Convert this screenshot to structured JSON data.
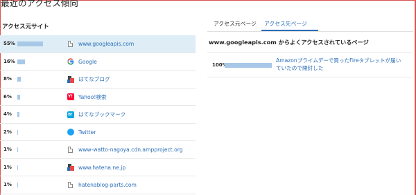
{
  "page": {
    "title": "最近のアクセス傾向",
    "border_color": "#d9534f",
    "accent_color": "#2a6db8",
    "bar_color": "#a7c8e6",
    "highlight_color": "#deedf6"
  },
  "referrers": {
    "heading": "アクセス元サイト",
    "rows": [
      {
        "percent": "55%",
        "value": 55,
        "icon": "document-icon",
        "label": "www.googleapis.com",
        "highlighted": true
      },
      {
        "percent": "16%",
        "value": 16,
        "icon": "google-icon",
        "label": "Google"
      },
      {
        "percent": "8%",
        "value": 8,
        "icon": "hatena-blog-icon",
        "label": "はてなブログ"
      },
      {
        "percent": "6%",
        "value": 6,
        "icon": "yahoo-icon",
        "label": "Yahoo!検索"
      },
      {
        "percent": "4%",
        "value": 4,
        "icon": "hatena-bookmark-icon",
        "label": "はてなブックマーク"
      },
      {
        "percent": "2%",
        "value": 2,
        "icon": "twitter-icon",
        "label": "Twitter"
      },
      {
        "percent": "1%",
        "value": 1,
        "icon": "document-icon",
        "label": "www-watto-nagoya.cdn.ampproject.org"
      },
      {
        "percent": "1%",
        "value": 1,
        "icon": "hatena-blog-icon",
        "label": "www.hatena.ne.jp"
      },
      {
        "percent": "1%",
        "value": 1,
        "icon": "document-icon",
        "label": "hatenablog-parts.com"
      }
    ]
  },
  "tabs": [
    {
      "label": "アクセス元ページ",
      "active": false
    },
    {
      "label": "アクセス先ページ",
      "active": true
    }
  ],
  "destination": {
    "heading": "www.googleapis.com からよくアクセスされているページ",
    "rows": [
      {
        "percent": "100%",
        "value": 100,
        "title": "Amazonプライムデーで買ったFireタブレットが届いていたので開封した"
      }
    ]
  }
}
